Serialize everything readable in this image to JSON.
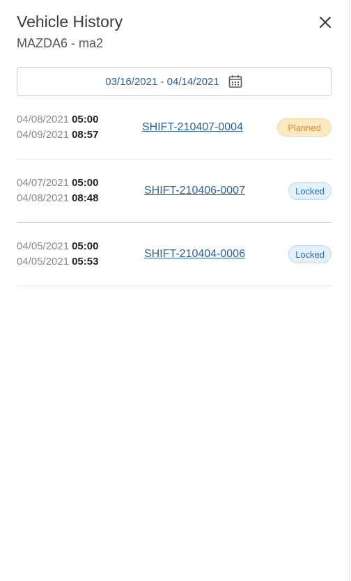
{
  "header": {
    "title": "Vehicle History",
    "subtitle": "MAZDA6 - ma2"
  },
  "filters": {
    "date_range": "03/16/2021 - 04/14/2021"
  },
  "icons": {
    "close": "close-icon",
    "calendar": "calendar-icon"
  },
  "colors": {
    "link": "#2a5f9e",
    "planned_bg": "#fde9c4",
    "planned_text": "#e58a12",
    "locked_bg": "#e3f1fc",
    "locked_text": "#2d6eae"
  },
  "shifts": [
    {
      "start_date": "04/08/2021",
      "start_time": "05:00",
      "end_date": "04/09/2021",
      "end_time": "08:57",
      "id": "SHIFT-210407-0004",
      "status": "Planned"
    },
    {
      "start_date": "04/07/2021",
      "start_time": "05:00",
      "end_date": "04/08/2021",
      "end_time": "08:48",
      "id": "SHIFT-210406-0007",
      "status": "Locked"
    },
    {
      "start_date": "04/05/2021",
      "start_time": "05:00",
      "end_date": "04/05/2021",
      "end_time": "05:53",
      "id": "SHIFT-210404-0006",
      "status": "Locked"
    }
  ]
}
